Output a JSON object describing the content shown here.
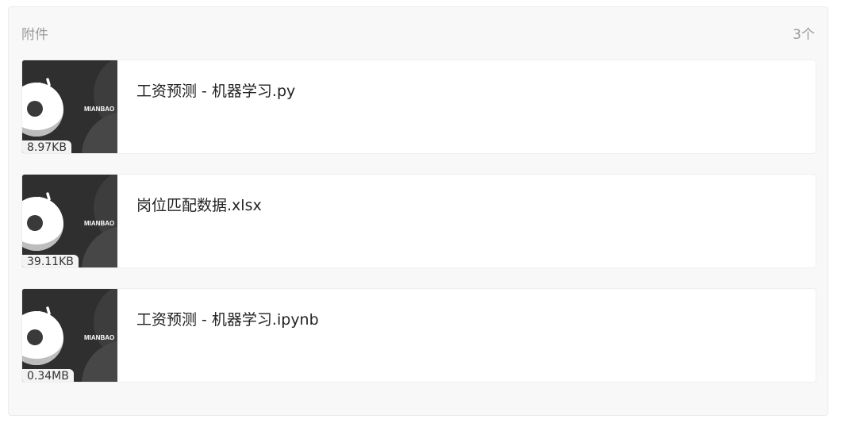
{
  "header": {
    "title": "附件",
    "count": "3个"
  },
  "attachments": [
    {
      "name": "工资预测 - 机器学习.py",
      "size": "8.97KB",
      "thumb_label": "MIANBAO"
    },
    {
      "name": "岗位匹配数据.xlsx",
      "size": "39.11KB",
      "thumb_label": "MIANBAO"
    },
    {
      "name": "工资预测 - 机器学习.ipynb",
      "size": "0.34MB",
      "thumb_label": "MIANBAO"
    }
  ],
  "colors": {
    "panel_bg": "#f8f8f8",
    "thumb_bg": "#2f2f2f",
    "muted_text": "#9a9a9a"
  }
}
